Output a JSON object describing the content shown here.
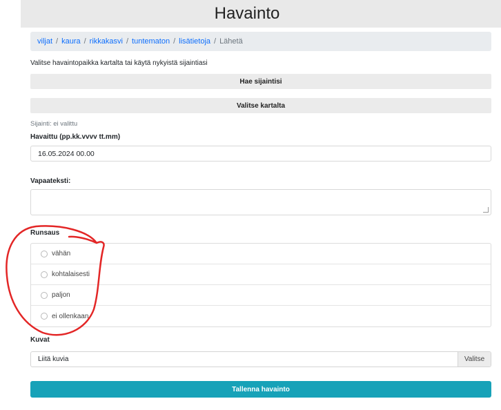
{
  "header": {
    "title": "Havainto"
  },
  "breadcrumb": {
    "items": [
      {
        "label": "viljat"
      },
      {
        "label": "kaura"
      },
      {
        "label": "rikkakasvi"
      },
      {
        "label": "tuntematon"
      },
      {
        "label": "lisätietoja"
      },
      {
        "label": "Lähetä"
      }
    ],
    "separator": "/"
  },
  "location": {
    "instruction": "Valitse havaintopaikka kartalta tai käytä nykyistä sijaintiasi",
    "get_location_label": "Hae sijaintisi",
    "choose_map_label": "Valitse kartalta",
    "status": "Sijainti: ei valittu"
  },
  "observed": {
    "label": "Havaittu (pp.kk.vvvv tt.mm)",
    "value": "16.05.2024 00.00"
  },
  "freetext": {
    "label": "Vapaateksti:",
    "value": ""
  },
  "abundance": {
    "label": "Runsaus",
    "options": [
      {
        "label": "vähän"
      },
      {
        "label": "kohtalaisesti"
      },
      {
        "label": "paljon"
      },
      {
        "label": "ei ollenkaan"
      }
    ]
  },
  "images": {
    "label": "Kuvat",
    "placeholder": "Liitä kuvia",
    "browse_label": "Valitse"
  },
  "submit": {
    "label": "Tallenna havainto"
  },
  "colors": {
    "primary": "#17a2b8",
    "link": "#0d6efd",
    "annotation": "#e32626"
  }
}
